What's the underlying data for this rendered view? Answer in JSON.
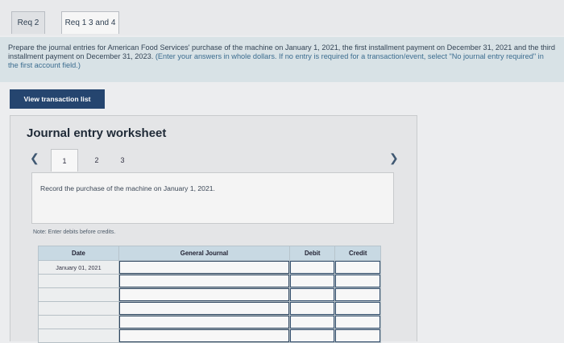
{
  "tabs": [
    {
      "label": "Req 2"
    },
    {
      "label": "Req 1 3 and 4"
    }
  ],
  "instructions": {
    "text": "Prepare the journal entries for American Food Services' purchase of the machine on January 1, 2021, the first installment payment on December 31, 2021 and the third installment payment on December 31, 2023.",
    "hint": "(Enter your answers in whole dollars. If no entry is required for a transaction/event, select \"No journal entry required\" in the first account field.)"
  },
  "view_transaction_list_label": "View transaction list",
  "worksheet": {
    "title": "Journal entry worksheet",
    "prev_icon": "chevron-left-icon",
    "next_icon": "chevron-right-icon",
    "steps": [
      "1",
      "2",
      "3"
    ],
    "description": "Record the purchase of the machine on January 1, 2021.",
    "note": "Note: Enter debits before credits."
  },
  "journal_table": {
    "headers": [
      "Date",
      "General Journal",
      "Debit",
      "Credit"
    ],
    "rows": [
      {
        "date": "January 01, 2021",
        "account": "",
        "debit": "",
        "credit": ""
      },
      {
        "date": "",
        "account": "",
        "debit": "",
        "credit": ""
      },
      {
        "date": "",
        "account": "",
        "debit": "",
        "credit": ""
      },
      {
        "date": "",
        "account": "",
        "debit": "",
        "credit": ""
      },
      {
        "date": "",
        "account": "",
        "debit": "",
        "credit": ""
      },
      {
        "date": "",
        "account": "",
        "debit": "",
        "credit": ""
      }
    ]
  }
}
